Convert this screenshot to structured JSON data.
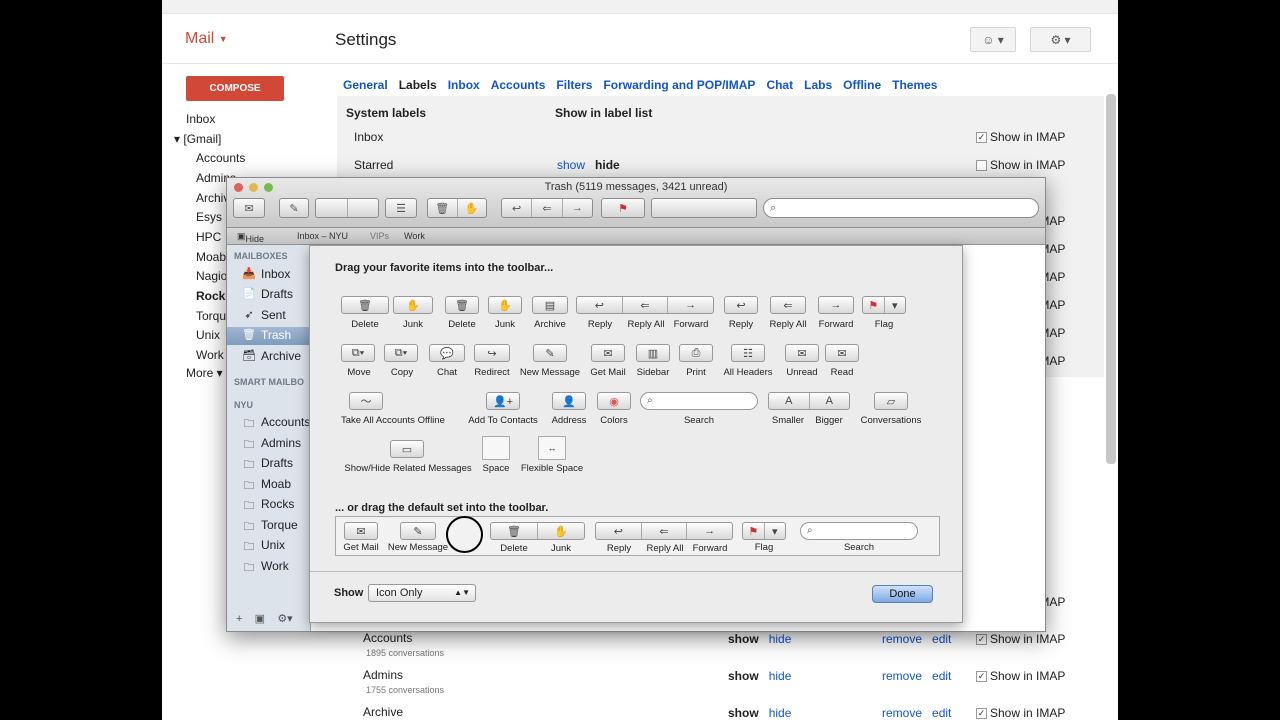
{
  "gmail": {
    "logo": "Mail",
    "page_title": "Settings",
    "compose": "COMPOSE",
    "nav": [
      "Inbox",
      "[Gmail]",
      "Accounts",
      "Admins",
      "Archive",
      "Esys",
      "HPC",
      "Moab",
      "Nagios",
      "Rocks",
      "Torque",
      "Unix",
      "Work",
      "More"
    ],
    "tabs": [
      "General",
      "Labels",
      "Inbox",
      "Accounts",
      "Filters",
      "Forwarding and POP/IMAP",
      "Chat",
      "Labs",
      "Offline",
      "Themes"
    ],
    "active_tab": "Labels",
    "system_labels_header": "System labels",
    "show_in_label_list_header": "Show in label list",
    "show_in_imap": "Show in IMAP",
    "show": "show",
    "hide": "hide",
    "remove": "remove",
    "edit": "edit",
    "rows": [
      {
        "name": "Inbox"
      },
      {
        "name": "Starred"
      }
    ],
    "bottom_rows": [
      {
        "name": "Accounts",
        "count": "1895 conversations"
      },
      {
        "name": "Admins",
        "count": "1755 conversations"
      },
      {
        "name": "Archive",
        "count": ""
      }
    ]
  },
  "mail_window": {
    "title": "Trash (5119 messages, 3421 unread)",
    "favorites": {
      "hide": "Hide",
      "items": [
        "Inbox – NYU",
        "VIPs",
        "Work"
      ]
    },
    "sidebar": {
      "mailboxes_header": "MAILBOXES",
      "mailboxes": [
        "Inbox",
        "Drafts",
        "Sent",
        "Trash",
        "Archive"
      ],
      "smart_header": "SMART MAILBO",
      "nyu_header": "NYU",
      "nyu": [
        "Accounts",
        "Admins",
        "Drafts",
        "Moab",
        "Rocks",
        "Torque",
        "Unix",
        "Work"
      ]
    }
  },
  "sheet": {
    "heading": "Drag your favorite items into the toolbar...",
    "row1": [
      "Delete",
      "Junk",
      "Delete",
      "Junk",
      "Archive",
      "Reply",
      "Reply All",
      "Forward",
      "Reply",
      "Reply All",
      "Forward",
      "Flag"
    ],
    "row2": [
      "Move",
      "Copy",
      "Chat",
      "Redirect",
      "New Message",
      "Get Mail",
      "Sidebar",
      "Print",
      "All Headers",
      "Unread",
      "Read"
    ],
    "row3": [
      "Take All Accounts Offline",
      "Add To Contacts",
      "Address",
      "Colors",
      "Search",
      "Smaller",
      "Bigger",
      "Conversations"
    ],
    "row4": [
      "Show/Hide Related Messages",
      "Space",
      "Flexible Space"
    ],
    "default_heading": "... or drag the default set into the toolbar.",
    "default_set": [
      "Get Mail",
      "New Message",
      "Delete",
      "Junk",
      "Reply",
      "Reply All",
      "Forward",
      "Flag",
      "Search"
    ],
    "show_label": "Show",
    "show_value": "Icon Only",
    "done": "Done"
  }
}
